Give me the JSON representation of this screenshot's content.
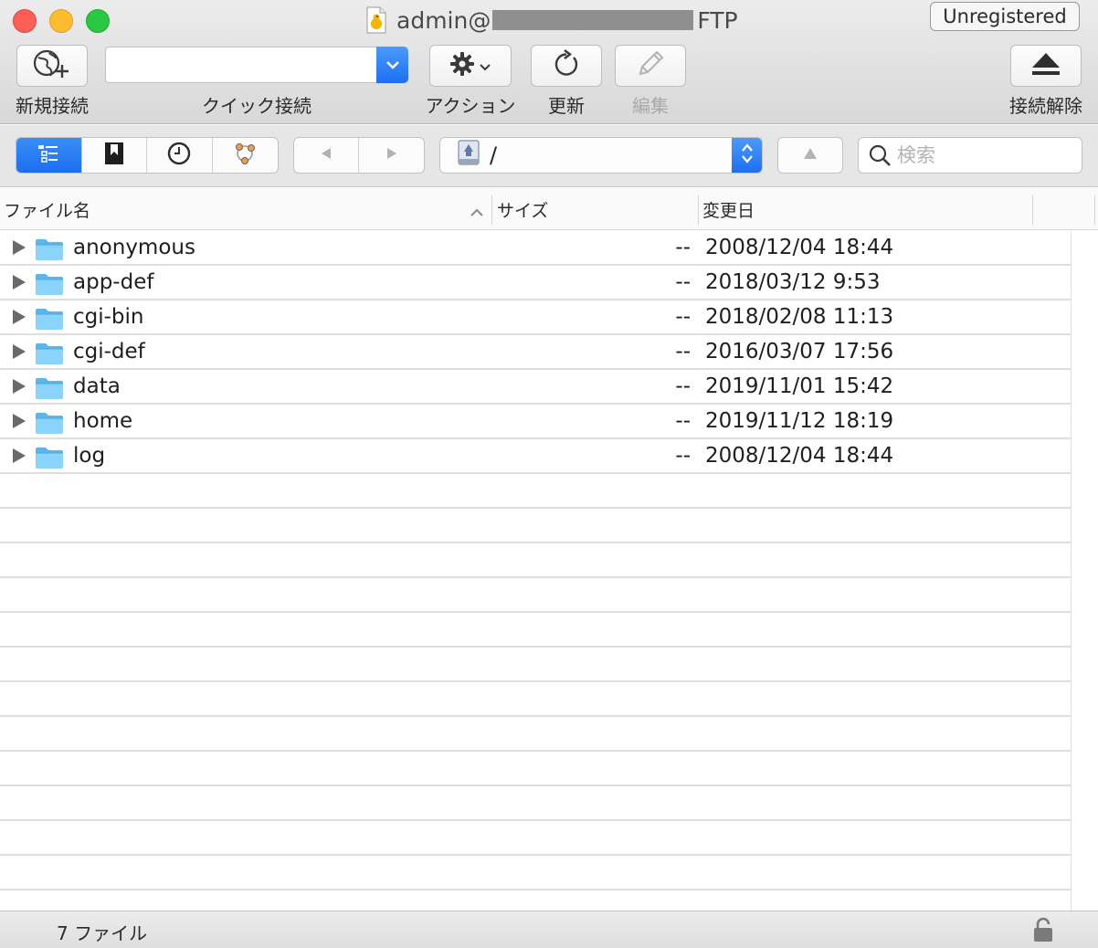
{
  "window": {
    "title_prefix": "admin@",
    "title_suffix": "FTP",
    "unregistered_label": "Unregistered"
  },
  "toolbar": {
    "new_connection_label": "新規接続",
    "quick_connect_label": "クイック接続",
    "quick_connect_value": "",
    "action_label": "アクション",
    "refresh_label": "更新",
    "edit_label": "編集",
    "disconnect_label": "接続解除"
  },
  "navbar": {
    "path": "/",
    "search_placeholder": "検索"
  },
  "columns": {
    "name": "ファイル名",
    "size": "サイズ",
    "modified": "変更日"
  },
  "files": [
    {
      "name": "anonymous",
      "size": "--",
      "modified": "2008/12/04 18:44"
    },
    {
      "name": "app-def",
      "size": "--",
      "modified": "2018/03/12 9:53"
    },
    {
      "name": "cgi-bin",
      "size": "--",
      "modified": "2018/02/08 11:13"
    },
    {
      "name": "cgi-def",
      "size": "--",
      "modified": "2016/03/07 17:56"
    },
    {
      "name": "data",
      "size": "--",
      "modified": "2019/11/01 15:42"
    },
    {
      "name": "home",
      "size": "--",
      "modified": "2019/11/12 18:19"
    },
    {
      "name": "log",
      "size": "--",
      "modified": "2008/12/04 18:44"
    }
  ],
  "status": {
    "file_count": "7 ファイル"
  },
  "colors": {
    "accent_blue": "#1d6ff2",
    "folder_blue": "#6cc4f5",
    "close_red": "#fd5f57",
    "minimize_yellow": "#febc2e",
    "zoom_green": "#28c840"
  }
}
